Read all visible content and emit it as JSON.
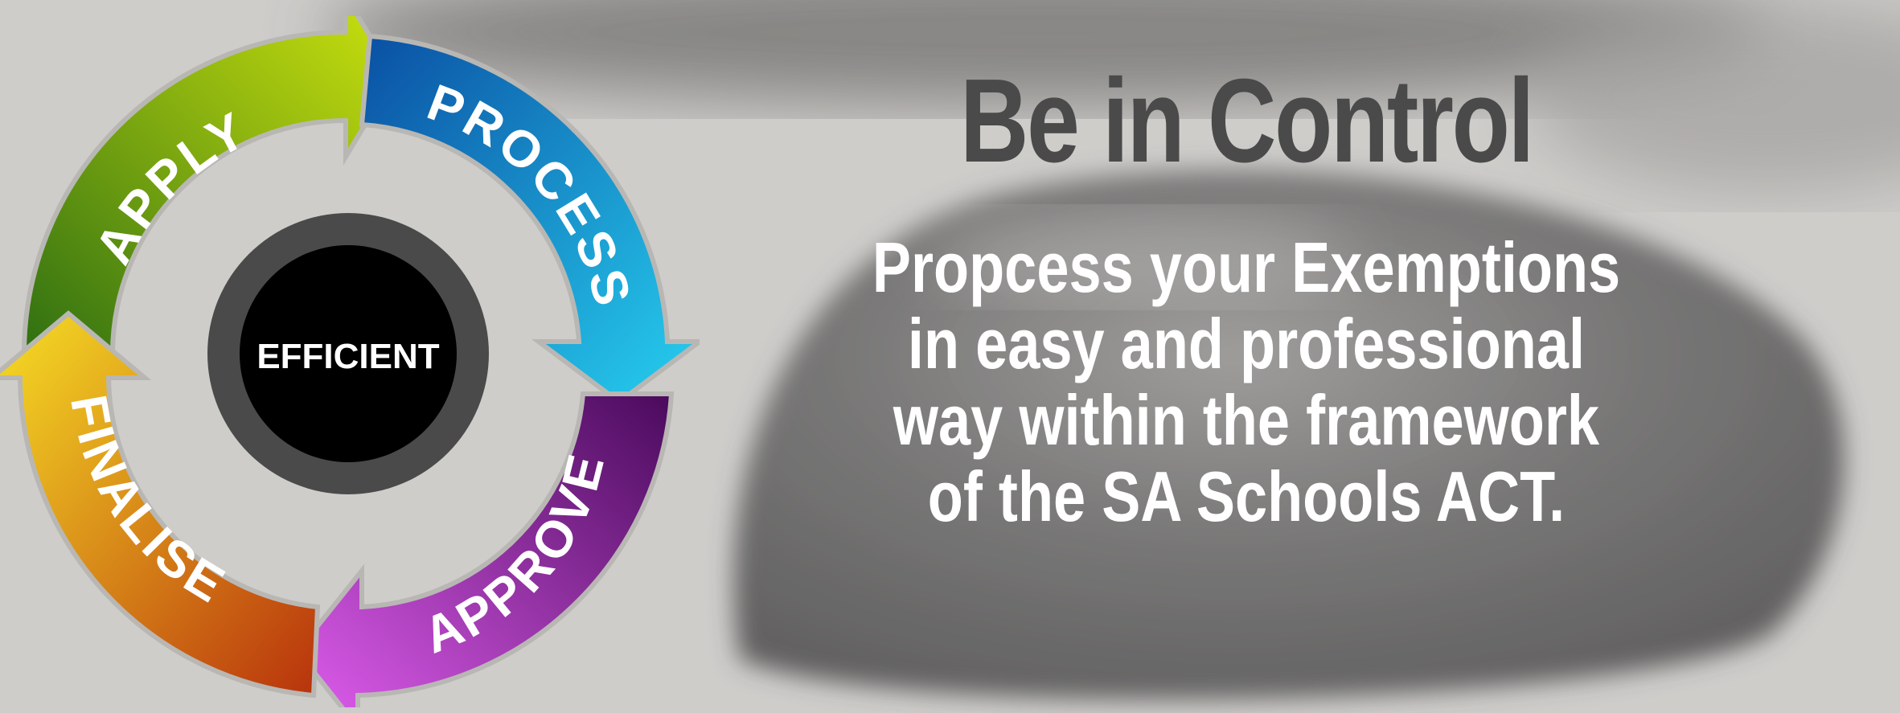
{
  "cycle": {
    "center_label": "EFFICIENT",
    "steps": [
      {
        "label": "APPLY",
        "color_start": "#cde30e",
        "color_end": "#2f6f12"
      },
      {
        "label": "PROCESS",
        "color_start": "#0a4fa3",
        "color_end": "#27d0f0"
      },
      {
        "label": "APPROVE",
        "color_start": "#4a0a5c",
        "color_end": "#e15ef0"
      },
      {
        "label": "FINALISE",
        "color_start": "#b8320c",
        "color_end": "#f7e025"
      }
    ]
  },
  "headline": "Be in Control",
  "body_lines": [
    "Propcess your Exemptions",
    "in easy and professional",
    "way within the framework",
    "of the SA Schools ACT."
  ]
}
